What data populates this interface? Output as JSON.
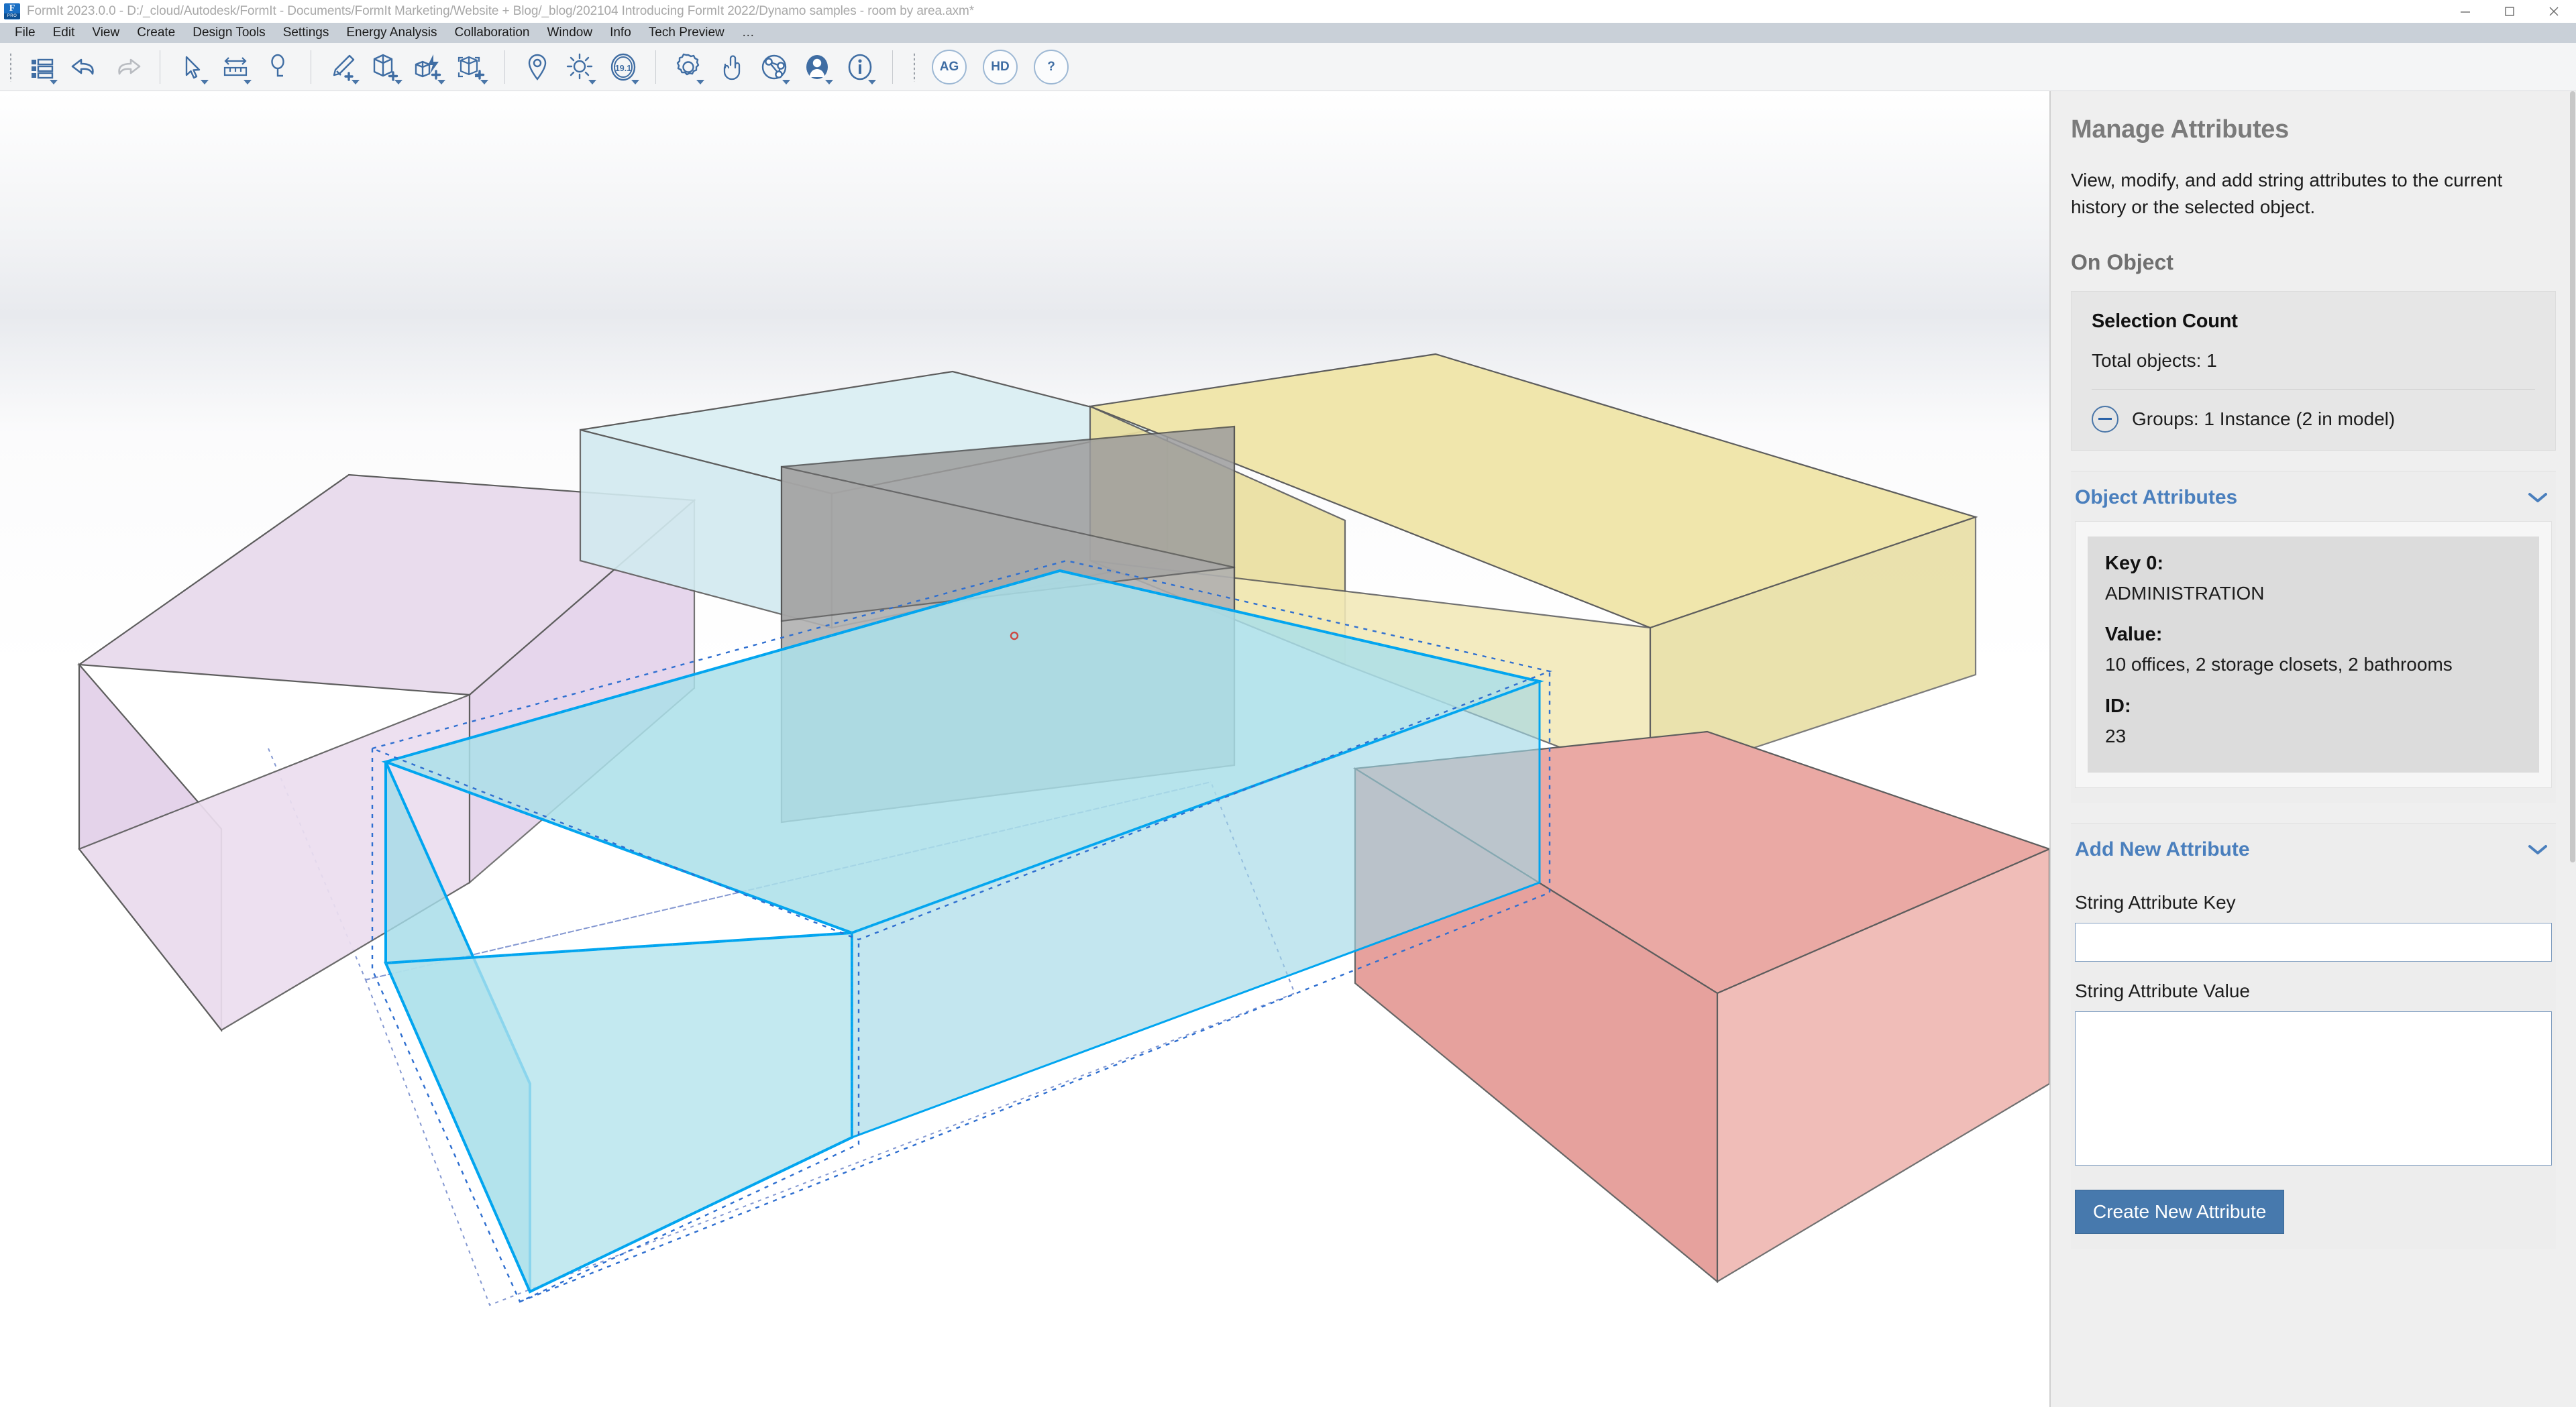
{
  "titlebar": {
    "title": "FormIt 2023.0.0 - D:/_cloud/Autodesk/FormIt - Documents/FormIt Marketing/Website + Blog/_blog/202104 Introducing FormIt 2022/Dynamo samples - room by area.axm*",
    "logo_letter": "F",
    "logo_badge": "PRO",
    "minimize_label": "Minimize",
    "maximize_label": "Maximize",
    "close_label": "Close"
  },
  "menubar": {
    "items": [
      {
        "label": "File"
      },
      {
        "label": "Edit"
      },
      {
        "label": "View"
      },
      {
        "label": "Create"
      },
      {
        "label": "Design Tools"
      },
      {
        "label": "Settings"
      },
      {
        "label": "Energy Analysis"
      },
      {
        "label": "Collaboration"
      },
      {
        "label": "Window"
      },
      {
        "label": "Info"
      },
      {
        "label": "Tech Preview"
      },
      {
        "label": "…"
      }
    ]
  },
  "toolbar": {
    "groups": [
      {
        "buttons": [
          {
            "icon": "layers-list-icon",
            "caret": true
          },
          {
            "icon": "undo-icon",
            "caret": false
          },
          {
            "icon": "redo-icon",
            "caret": false
          }
        ]
      },
      {
        "buttons": [
          {
            "icon": "select-cursor-icon",
            "caret": true
          },
          {
            "icon": "measure-ruler-icon",
            "caret": true
          },
          {
            "icon": "sketch-spline-icon",
            "caret": false
          }
        ]
      },
      {
        "buttons": [
          {
            "icon": "draw-pencil-add-icon",
            "caret": true
          },
          {
            "icon": "create-solid-add-icon",
            "caret": true
          },
          {
            "icon": "dynamo-bolt-add-icon",
            "caret": true
          },
          {
            "icon": "group-add-icon",
            "caret": true
          }
        ]
      },
      {
        "buttons": [
          {
            "icon": "location-pin-icon",
            "caret": false
          },
          {
            "icon": "sun-shadow-icon",
            "caret": true
          },
          {
            "icon": "level-19-1-icon",
            "caret": true,
            "text": "19.1"
          }
        ]
      },
      {
        "buttons": [
          {
            "icon": "gear-settings-icon",
            "caret": true
          },
          {
            "icon": "hand-touch-icon",
            "caret": false
          },
          {
            "icon": "share-network-icon",
            "caret": true
          },
          {
            "icon": "user-account-icon",
            "caret": true
          },
          {
            "icon": "info-icon",
            "caret": true
          }
        ]
      }
    ],
    "round_buttons": [
      {
        "icon": "ag-badge-icon",
        "label": "AG"
      },
      {
        "icon": "hd-badge-icon",
        "label": "HD"
      },
      {
        "icon": "help-icon",
        "label": "?"
      }
    ]
  },
  "panel": {
    "title": "Manage Attributes",
    "description": "View, modify, and add string attributes to the current history or the selected object.",
    "on_object_heading": "On Object",
    "selection_count": {
      "heading": "Selection Count",
      "total_objects": "Total objects: 1",
      "groups": "Groups: 1 Instance (2 in model)",
      "toggle_icon": "minus-circle-icon"
    },
    "object_attributes": {
      "heading": "Object Attributes",
      "chevron_icon": "chevron-down-icon",
      "rows": [
        {
          "label": "Key 0:",
          "value": "ADMINISTRATION"
        },
        {
          "label": "Value:",
          "value": "10 offices, 2 storage closets, 2 bathrooms"
        },
        {
          "label": "ID:",
          "value": "23"
        }
      ]
    },
    "add_new_attribute": {
      "heading": "Add New Attribute",
      "chevron_icon": "chevron-down-icon",
      "key_label": "String Attribute Key",
      "key_value": "",
      "key_placeholder": "",
      "value_label": "String Attribute Value",
      "value_value": "",
      "value_placeholder": "",
      "create_button": "Create New Attribute"
    }
  },
  "viewport": {
    "name": "3d-model-viewport",
    "selected_object_color": "#00a5f0",
    "masses": [
      {
        "name": "lavender-mass",
        "fill": "#e7d7ec",
        "stroke": "#6a6a6a"
      },
      {
        "name": "pale-cyan-mass",
        "fill": "#d8edf1",
        "stroke": "#6a6a6a"
      },
      {
        "name": "grey-mass",
        "fill": "#a8a8a8",
        "stroke": "#5a5a5a"
      },
      {
        "name": "yellow-mass",
        "fill": "#efe4a8",
        "stroke": "#6a6a6a"
      },
      {
        "name": "salmon-mass",
        "fill": "#e9a7a2",
        "stroke": "#6a6a6a"
      },
      {
        "name": "selected-cyan-mass",
        "fill": "#a8dce8",
        "stroke": "#00a5f0"
      }
    ]
  },
  "colors": {
    "accent": "#4779ad",
    "panel_bg": "#efefef",
    "menu_bg": "#c9d0d8",
    "toolbar_bg": "#f4f5f6",
    "selection_blue": "#00a5f0",
    "section_heading": "#4a7fbd"
  }
}
